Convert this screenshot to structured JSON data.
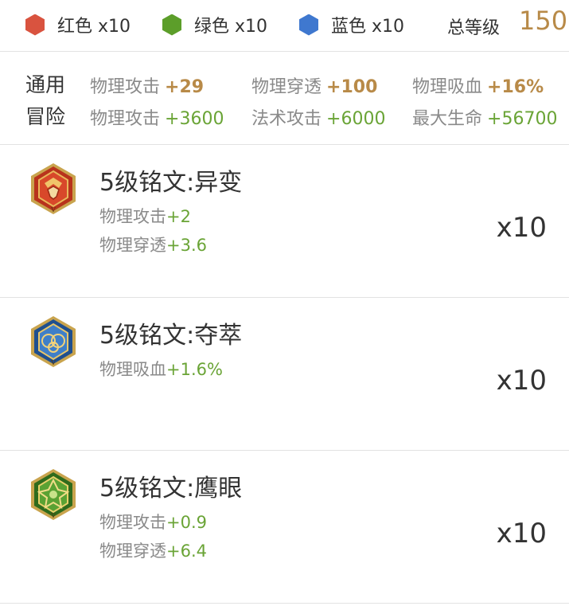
{
  "gems": [
    {
      "label": "红色 x10",
      "color": "#d9533f",
      "icon": "red-hexagon-icon"
    },
    {
      "label": "绿色 x10",
      "color": "#5c9e2a",
      "icon": "green-hexagon-icon"
    },
    {
      "label": "蓝色 x10",
      "color": "#3f78cf",
      "icon": "blue-hexagon-icon"
    }
  ],
  "total": {
    "label": "总等级",
    "value": "150"
  },
  "stats": {
    "general": {
      "label": "通用",
      "items": [
        {
          "name": "物理攻击",
          "value": "+29"
        },
        {
          "name": "物理穿透",
          "value": "+100"
        },
        {
          "name": "物理吸血",
          "value": "+16%"
        }
      ]
    },
    "adventure": {
      "label": "冒险",
      "items": [
        {
          "name": "物理攻击",
          "value": "+3600"
        },
        {
          "name": "法术攻击",
          "value": "+6000"
        },
        {
          "name": "最大生命",
          "value": "+56700"
        }
      ]
    }
  },
  "runes": [
    {
      "name": "5级铭文:异变",
      "icon": "red-rune-icon",
      "count": "x10",
      "attrs": [
        {
          "name": "物理攻击",
          "value": "+2"
        },
        {
          "name": "物理穿透",
          "value": "+3.6"
        }
      ]
    },
    {
      "name": "5级铭文:夺萃",
      "icon": "blue-rune-icon",
      "count": "x10",
      "attrs": [
        {
          "name": "物理吸血",
          "value": "+1.6%"
        }
      ]
    },
    {
      "name": "5级铭文:鹰眼",
      "icon": "green-rune-icon",
      "count": "x10",
      "attrs": [
        {
          "name": "物理攻击",
          "value": "+0.9"
        },
        {
          "name": "物理穿透",
          "value": "+6.4"
        }
      ]
    }
  ]
}
